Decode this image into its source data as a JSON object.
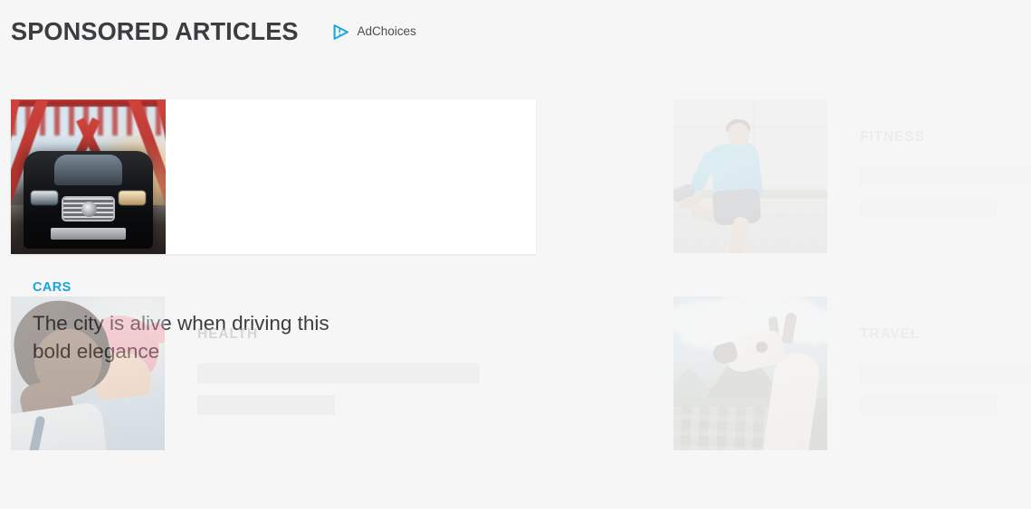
{
  "header": {
    "title": "SPONSORED ARTICLES",
    "adchoices": {
      "label": "AdChoices",
      "icon": "adchoices-triangle-icon",
      "icon_color": "#19A8DC"
    }
  },
  "theme": {
    "page_background": "#f6f6f6",
    "card_background": "#ffffff",
    "accent": "#18a4de",
    "heading_text": "#3b3e41",
    "muted_kicker": "#a9acae",
    "placeholder_bar": "#e6e7e8"
  },
  "cards": [
    {
      "id": "cars",
      "state": "loaded",
      "kicker": "CARS",
      "kicker_color": "#18a4de",
      "headline": "The city is alive when driving this bold elegance",
      "image": "black-car-on-red-bridge-at-sunset-photo",
      "position": "top-left"
    },
    {
      "id": "fitness",
      "state": "loading",
      "kicker": "FITNESS",
      "kicker_color": "#d8dadc",
      "headline": "",
      "image": "man-running-beside-concrete-wall-photo",
      "position": "top-right"
    },
    {
      "id": "health",
      "state": "loading",
      "kicker": "HEALTH",
      "kicker_color": "#a9acae",
      "headline": "",
      "image": "doctor-with-child-in-pink-headscarf-photo",
      "position": "bottom-left"
    },
    {
      "id": "travel",
      "state": "loading",
      "kicker": "TRAVEL",
      "kicker_color": "#d8dadc",
      "headline": "",
      "image": "llama-at-machu-picchu-photo",
      "position": "bottom-right"
    }
  ]
}
